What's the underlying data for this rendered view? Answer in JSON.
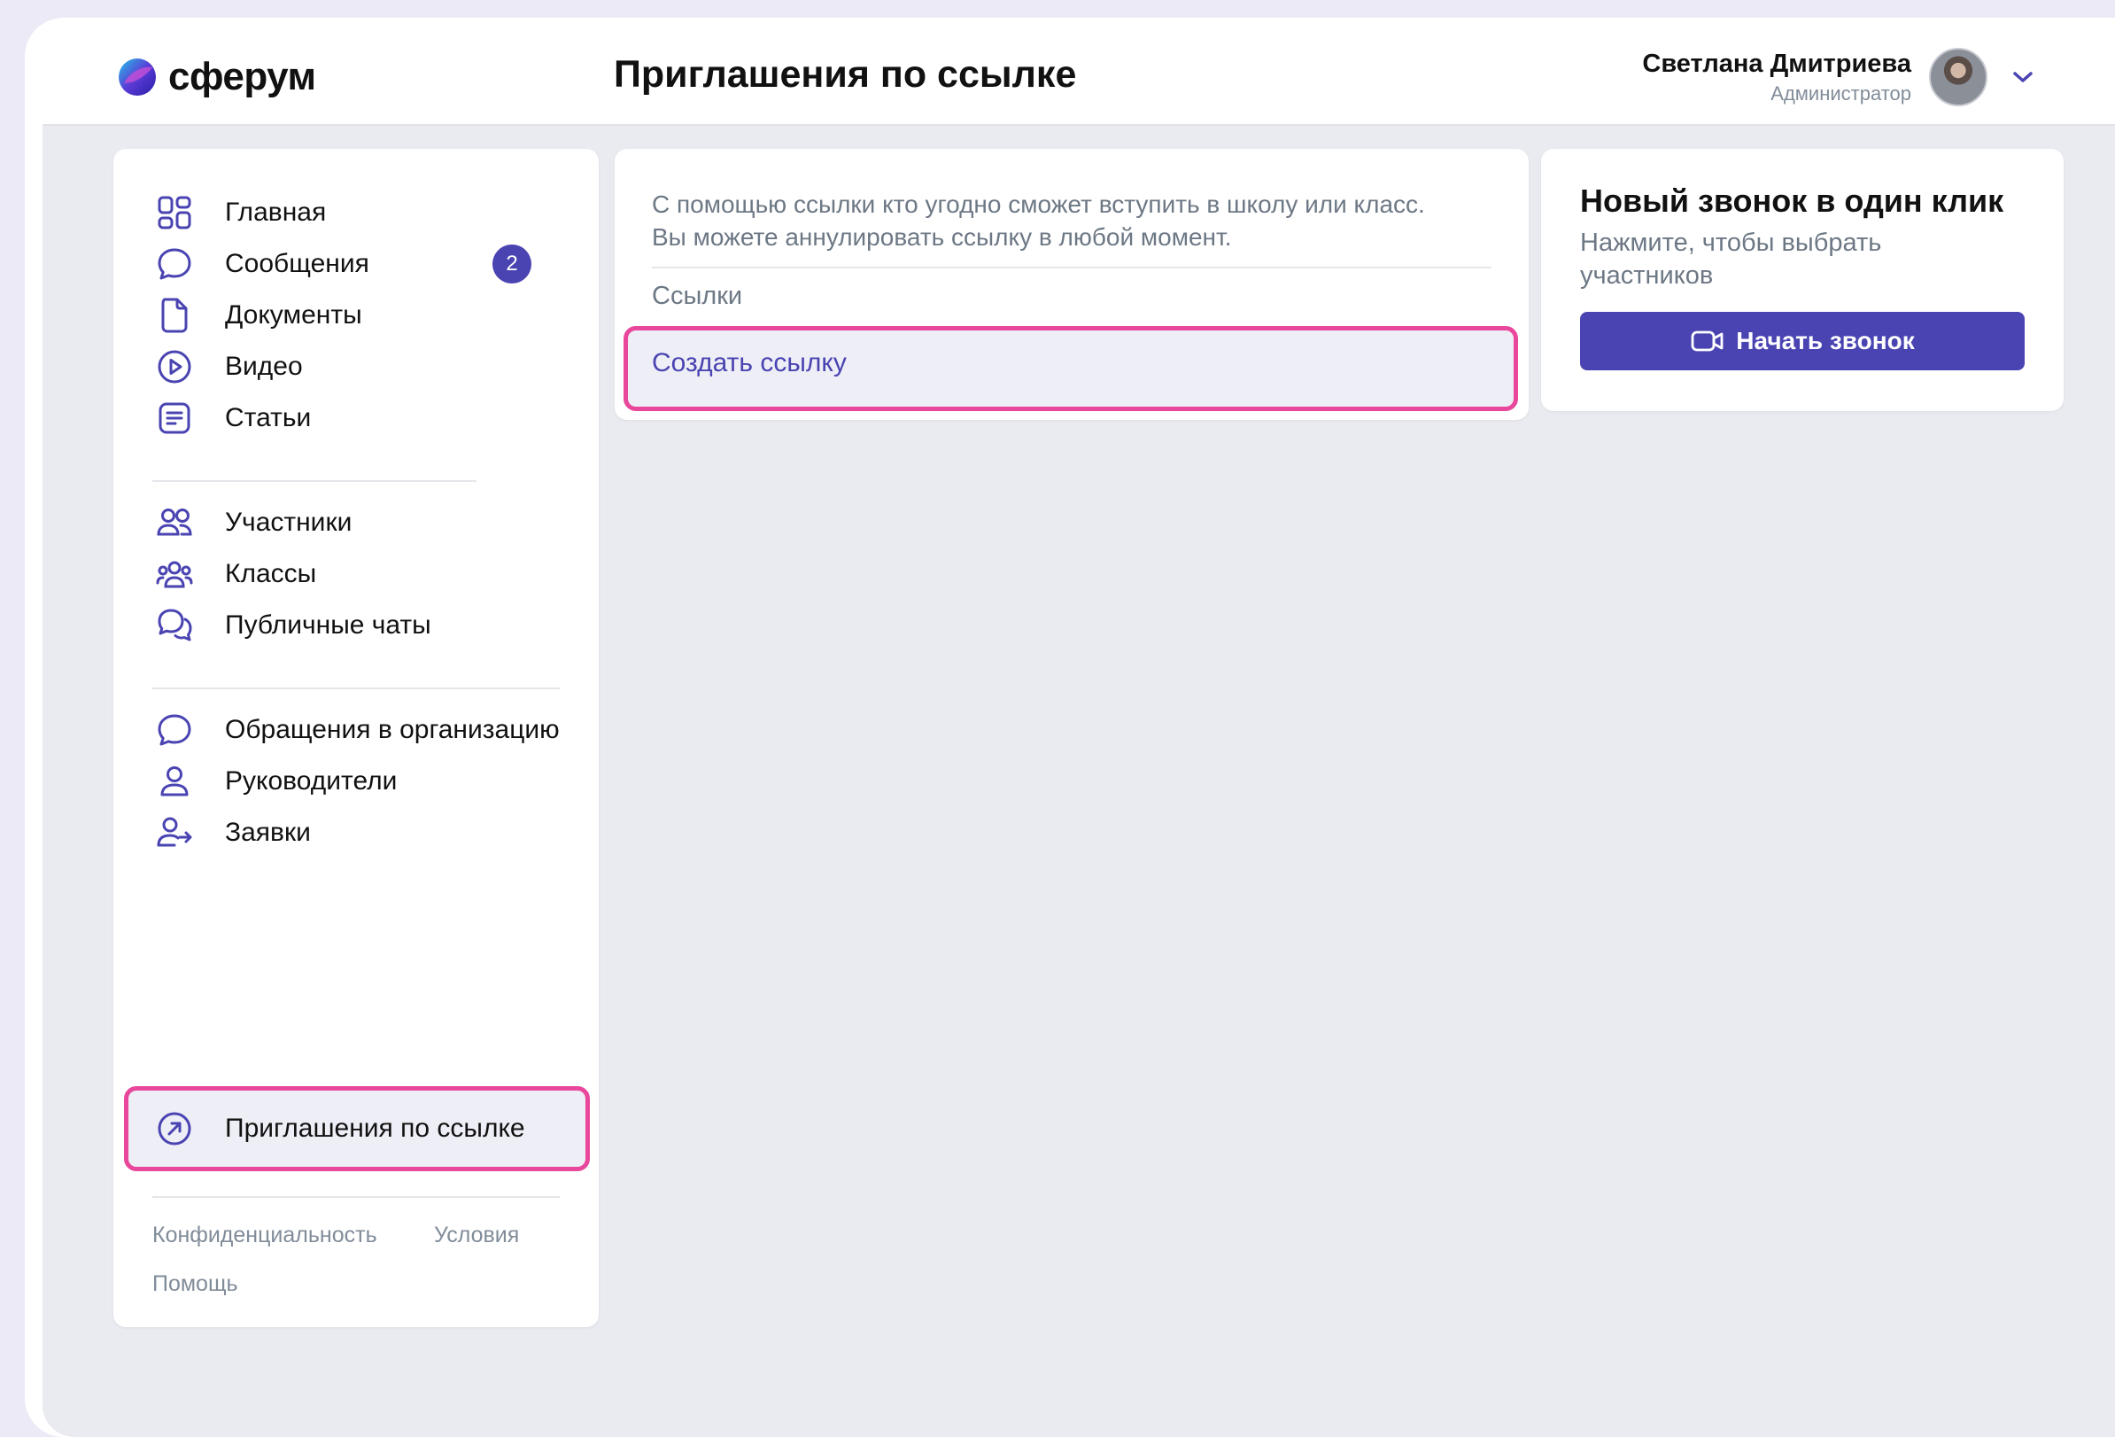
{
  "app": {
    "logo_text": "сферум",
    "page_title": "Приглашения по ссылке",
    "colors": {
      "accent": "#4a44b2",
      "highlight": "#e8479b",
      "muted": "#6d7885"
    }
  },
  "user": {
    "name": "Светлана Дмитриева",
    "role": "Администратор"
  },
  "sidebar": {
    "items": [
      {
        "label": "Главная",
        "icon": "grid-icon"
      },
      {
        "label": "Сообщения",
        "icon": "message-icon",
        "badge": "2"
      },
      {
        "label": "Документы",
        "icon": "document-icon"
      },
      {
        "label": "Видео",
        "icon": "play-icon"
      },
      {
        "label": "Статьи",
        "icon": "article-icon"
      },
      {
        "label": "Участники",
        "icon": "users-icon"
      },
      {
        "label": "Классы",
        "icon": "group-icon"
      },
      {
        "label": "Публичные чаты",
        "icon": "chats-icon"
      },
      {
        "label": "Обращения в организацию",
        "icon": "message-icon"
      },
      {
        "label": "Руководители",
        "icon": "person-icon"
      },
      {
        "label": "Заявки",
        "icon": "person-arrow-icon"
      },
      {
        "label": "Приглашения по ссылке",
        "icon": "link-arrow-icon",
        "active": true
      }
    ],
    "footer": {
      "privacy": "Конфиденциальность",
      "terms": "Условия",
      "help": "Помощь"
    }
  },
  "links_panel": {
    "description": "С помощью ссылки кто угодно сможет вступить в школу или класс. Вы можете аннулировать ссылку в любой момент.",
    "section_label": "Ссылки",
    "create_label": "Создать ссылку"
  },
  "call_panel": {
    "title": "Новый звонок в один клик",
    "subtitle": "Нажмите, чтобы выбрать участников",
    "button_label": "Начать звонок"
  }
}
